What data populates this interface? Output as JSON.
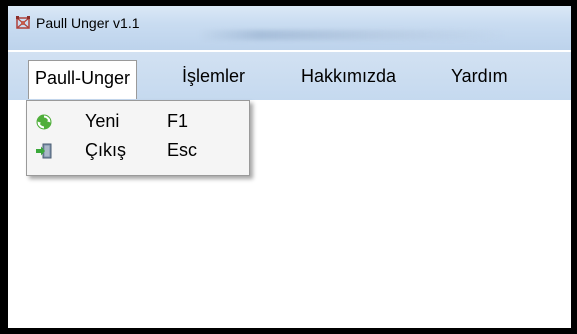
{
  "window": {
    "title": "Paull Unger v1.1"
  },
  "menubar": {
    "items": [
      {
        "label": "Paull-Unger"
      },
      {
        "label": "İşlemler"
      },
      {
        "label": "Hakkımızda"
      },
      {
        "label": "Yardım"
      }
    ]
  },
  "dropdown": {
    "items": [
      {
        "label": "Yeni",
        "shortcut": "F1",
        "icon": "new-recycle-icon"
      },
      {
        "label": "Çıkış",
        "shortcut": "Esc",
        "icon": "exit-door-icon"
      }
    ]
  },
  "colors": {
    "titlebar": "#c9dcf1",
    "menubar": "#c5d9ef",
    "dropdown_bg": "#f5f5f5",
    "app_icon": "#b0403a"
  }
}
